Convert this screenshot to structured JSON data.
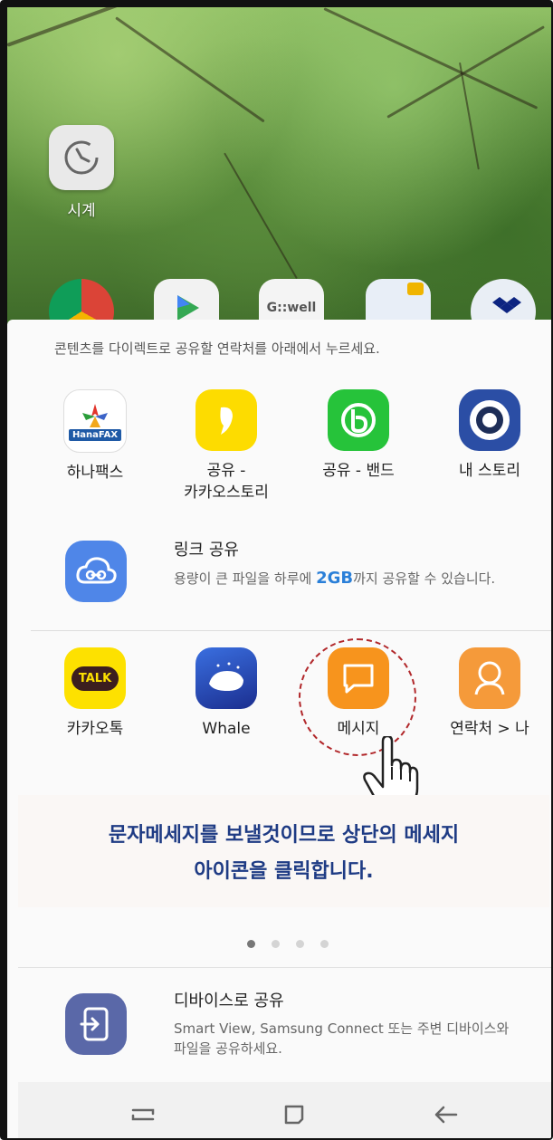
{
  "home": {
    "clock_label": "시계",
    "dock_partial_text": "G::well"
  },
  "share_sheet": {
    "title": "콘텐츠를 다이렉트로 공유할 연락처를 아래에서 누르세요.",
    "direct_apps": [
      {
        "label": "하나팩스",
        "icon": "hanafax-icon",
        "icon_text": "HanaFAX"
      },
      {
        "label_line1": "공유 -",
        "label_line2": "카카오스토리",
        "icon": "kakaostory-icon"
      },
      {
        "label": "공유 - 밴드",
        "icon": "band-icon"
      },
      {
        "label": "내 스토리",
        "icon": "my-story-camera-icon"
      }
    ],
    "link_share": {
      "title": "링크 공유",
      "desc_before": "용량이 큰 파일을 하루에 ",
      "desc_highlight": "2GB",
      "desc_after": "까지 공유할 수 있습니다."
    },
    "apps": [
      {
        "label": "카카오톡",
        "icon": "kakaotalk-icon",
        "icon_text": "TALK"
      },
      {
        "label": "Whale",
        "icon": "whale-icon"
      },
      {
        "label": "메시지",
        "icon": "message-icon"
      },
      {
        "label": "연락처 > 나",
        "icon": "contact-icon"
      }
    ],
    "instruction_line1": "문자메세지를 보낼것이므로 상단의 메세지",
    "instruction_line2": "아이콘을 클릭합니다.",
    "page_dots": {
      "count": 4,
      "active": 1
    },
    "device_share": {
      "title": "디바이스로 공유",
      "desc": "Smart View, Samsung Connect 또는 주변 디바이스와 파일을 공유하세요."
    }
  },
  "navbar": {
    "buttons": [
      "recent-apps-icon",
      "home-icon",
      "back-icon"
    ]
  },
  "colors": {
    "accent_blue": "#2a7fd8",
    "instruction_text": "#1e3b84",
    "highlight_circle": "#b1272a",
    "message_orange": "#f7941d"
  }
}
